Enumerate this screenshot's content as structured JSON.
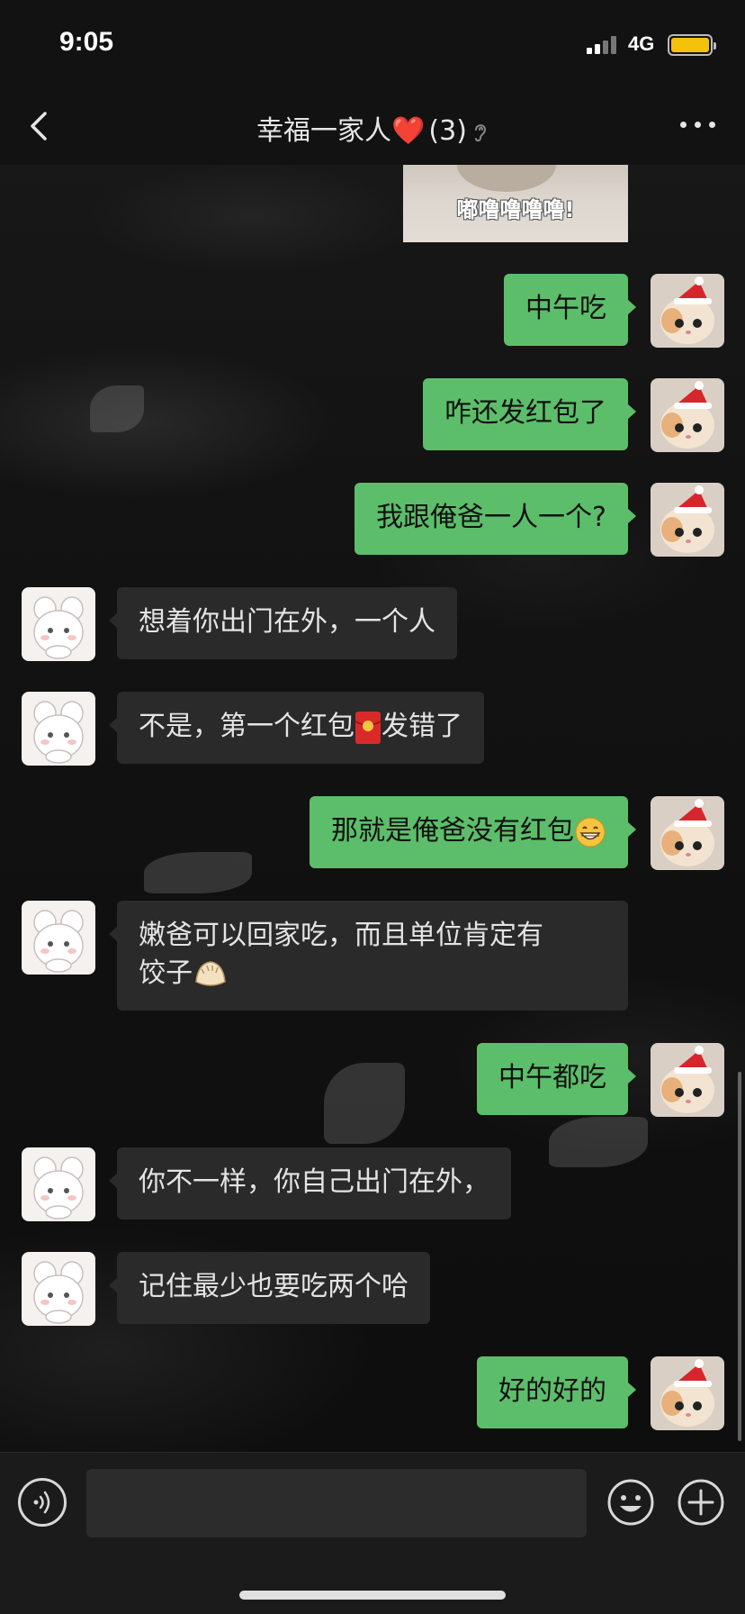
{
  "status_bar": {
    "time": "9:05",
    "network": "4G"
  },
  "header": {
    "title": "幸福一家人",
    "member_count": "(3)",
    "heart_emoji": "❤️"
  },
  "sticker": {
    "caption": "嘟噜噜噜噜!"
  },
  "messages": [
    {
      "direction": "out",
      "text": "中午吃"
    },
    {
      "direction": "out",
      "text": "咋还发红包了"
    },
    {
      "direction": "out",
      "text": "我跟俺爸一人一个?"
    },
    {
      "direction": "in",
      "text": "想着你出门在外，一个人"
    },
    {
      "direction": "in",
      "text_before": "不是，第一个红包",
      "emoji": "red-envelope",
      "text_after": "发错了"
    },
    {
      "direction": "out",
      "text": "那就是俺爸没有红包",
      "emoji": "grinning-face"
    },
    {
      "direction": "in",
      "line1": "嫩爸可以回家吃，而且单位肯定有",
      "line2": "饺子",
      "emoji": "dumpling"
    },
    {
      "direction": "out",
      "text": "中午都吃"
    },
    {
      "direction": "in",
      "text": "你不一样，你自己出门在外，"
    },
    {
      "direction": "in",
      "text": "记住最少也要吃两个哈"
    },
    {
      "direction": "out",
      "text": "好的好的"
    }
  ],
  "input": {
    "value": "",
    "placeholder": ""
  },
  "colors": {
    "outgoing_bubble": "#5cbe6a",
    "incoming_bubble": "#2a2a2a",
    "battery": "#f4c20d"
  },
  "icons": {
    "back": "back-chevron-icon",
    "more": "more-dots-icon",
    "voice": "voice-icon",
    "emoji": "emoji-icon",
    "plus": "plus-icon"
  }
}
